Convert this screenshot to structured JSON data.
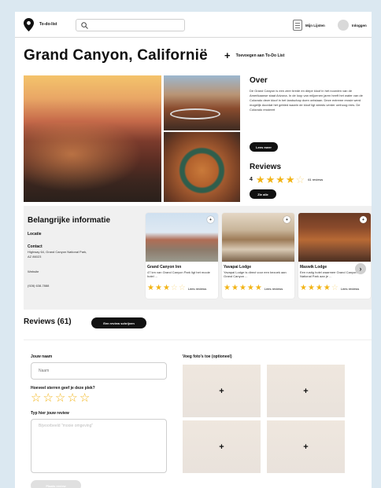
{
  "header": {
    "logo_text": "To-do-list",
    "search_placeholder": "",
    "my_lists_label": "Mijn Lijsten",
    "login_label": "Inloggen"
  },
  "title": {
    "text": "Grand Canyon, Californië",
    "add_todo_label": "Toevoegen aan To-Do List"
  },
  "about": {
    "title": "Over",
    "text": "De Grand Canyon is een zeer brede en diepe kloof in het noorden van de Amerikaanse staat Arizona. In de loop van miljoenen jaren heeft het water van de Colorado deze kloof in het landschap doen ontstaan. Deze extreme erosie werd mogelijk doordat het gebied waarin de kloof ligt steeds verder omhoog rees. De Colorado erodeert",
    "read_more_label": "Lees meer"
  },
  "reviews_summary": {
    "title": "Reviews",
    "score": "4",
    "stars": 4,
    "count_text": "61 reviews",
    "see_all_label": "Zie alle"
  },
  "info": {
    "title": "Belangrijke informatie",
    "location_heading": "Locatie",
    "contact_heading": "Contact",
    "address": "Highway 64, Grand Canyon National Park, AZ 86023",
    "website": "Website",
    "phone": "(928) 638-7888"
  },
  "cards": [
    {
      "badge": "+",
      "name": "Grand Canyon Inn",
      "desc": "47 km van Grand Canyon Park ligt het mooie hotel ...",
      "stars": 3,
      "link": "Lees reviews"
    },
    {
      "badge": "+",
      "name": "Yavapai Lodge",
      "desc": "Yavapai Lodge is direct voor een bezoek aan Grand Canyon ...",
      "stars": 5,
      "link": "Lees reviews"
    },
    {
      "badge": "+",
      "name": "Maswik Lodge",
      "desc": "Een rustig hotel waarmee Grand Canyon National Park aan je ...",
      "stars": 4,
      "link": "Lees reviews"
    }
  ],
  "review_form": {
    "heading": "Reviews (61)",
    "write_label": "Een review schrijven",
    "name_label": "Jouw naam",
    "name_placeholder": "Naam",
    "stars_label": "Hoeveel sterren geef je deze plek?",
    "review_label": "Typ hier jouw review",
    "review_placeholder": "Bijvoorbeeld \"mooie omgeving\"",
    "submit_label": "Plaats review",
    "photos_label": "Voeg foto's toe (optioneel)",
    "upload_icon": "+"
  },
  "colors": {
    "star": "#f2b417",
    "dark_button": "#111111",
    "panel": "#f0f0f0"
  }
}
